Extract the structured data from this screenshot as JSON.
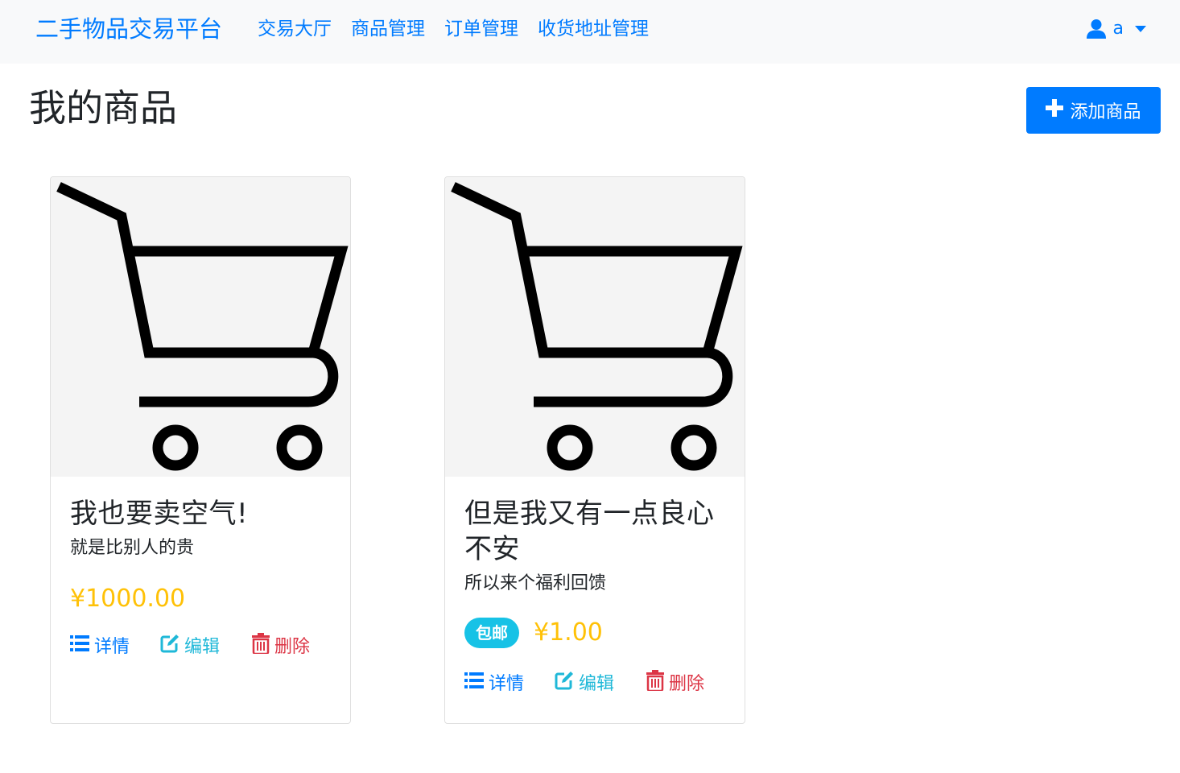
{
  "navbar": {
    "brand": "二手物品交易平台",
    "links": [
      "交易大厅",
      "商品管理",
      "订单管理",
      "收货地址管理"
    ],
    "user": "a"
  },
  "page": {
    "title": "我的商品",
    "add_button": "添加商品"
  },
  "products": [
    {
      "title": "我也要卖空气!",
      "description": "就是比别人的贵",
      "badge": "",
      "price": "¥1000.00",
      "actions": {
        "detail": "详情",
        "edit": "编辑",
        "delete": "删除"
      }
    },
    {
      "title": "但是我又有一点良心不安",
      "description": "所以来个福利回馈",
      "badge": "包邮",
      "price": "¥1.00",
      "actions": {
        "detail": "详情",
        "edit": "编辑",
        "delete": "删除"
      }
    }
  ],
  "colors": {
    "primary": "#007bff",
    "price": "#ffc107",
    "badge": "#17c2e6",
    "danger": "#dc3545",
    "navbar_bg": "#f8f9fa"
  },
  "icons": [
    "user-icon",
    "caret-down-icon",
    "plus-icon",
    "cart-icon",
    "list-icon",
    "edit-icon",
    "trash-icon"
  ]
}
